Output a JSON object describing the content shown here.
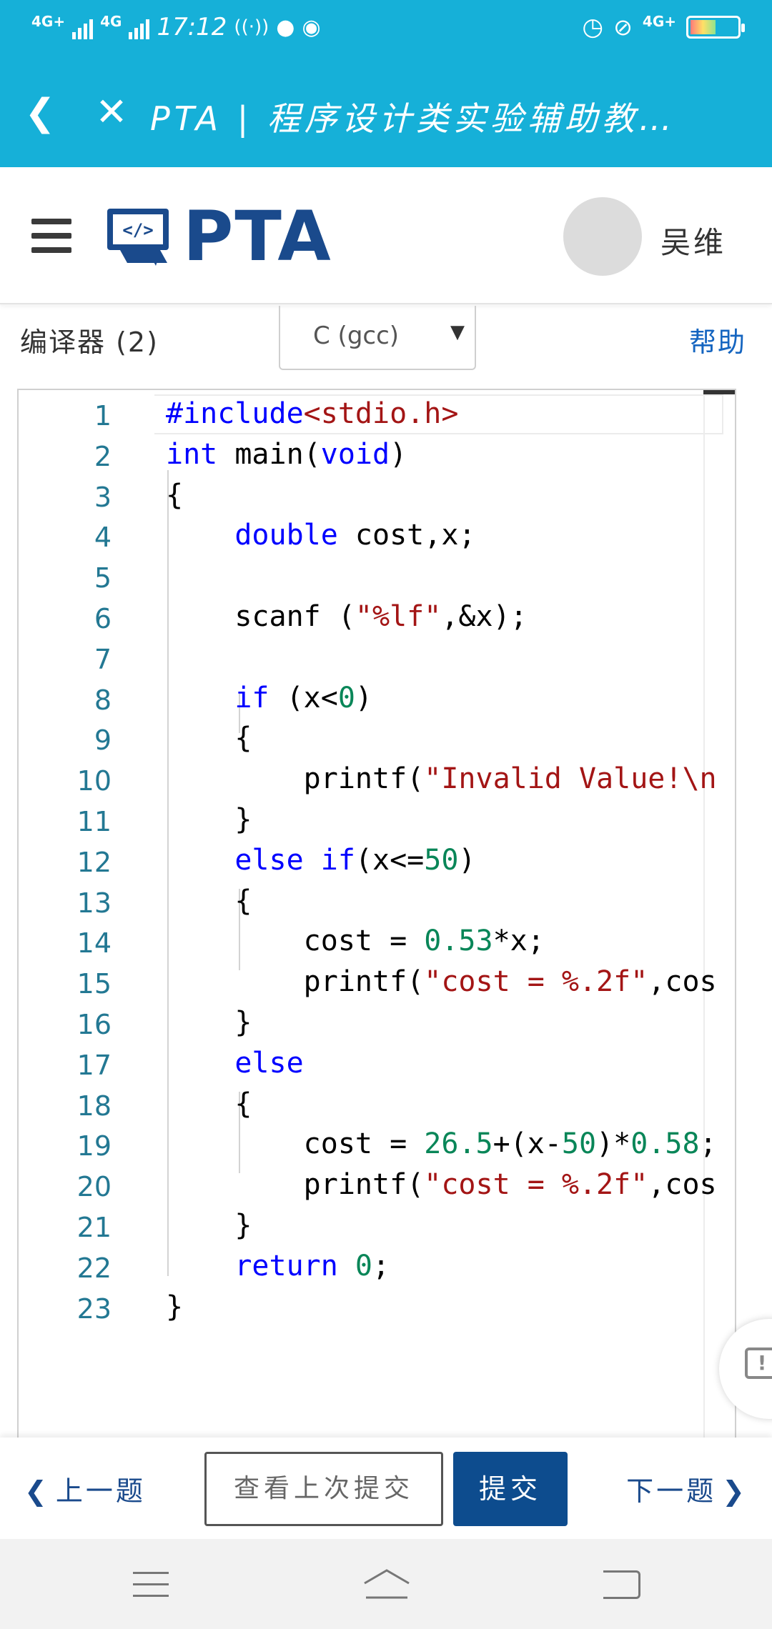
{
  "status_bar": {
    "net1": "4G+",
    "net2": "4G",
    "time": "17:12",
    "net_right": "4G+",
    "battery_level": 0.55
  },
  "browser": {
    "title": "PTA | 程序设计类实验辅助教…"
  },
  "header": {
    "logo_text": "PTA",
    "username": "吴维"
  },
  "toolbar": {
    "compiler_label": "编译器 (2)",
    "language": "C (gcc)",
    "help": "帮助"
  },
  "editor": {
    "lines": [
      {
        "n": "1",
        "tokens": [
          {
            "t": "#include",
            "c": "inc"
          },
          {
            "t": "<stdio.h>",
            "c": "str"
          }
        ]
      },
      {
        "n": "2",
        "tokens": [
          {
            "t": "int",
            "c": "kw"
          },
          {
            "t": " main(",
            "c": ""
          },
          {
            "t": "void",
            "c": "kw"
          },
          {
            "t": ")",
            "c": ""
          }
        ]
      },
      {
        "n": "3",
        "tokens": [
          {
            "t": "{",
            "c": ""
          }
        ]
      },
      {
        "n": "4",
        "tokens": [
          {
            "t": "    ",
            "c": ""
          },
          {
            "t": "double",
            "c": "kw"
          },
          {
            "t": " cost,x;",
            "c": ""
          }
        ]
      },
      {
        "n": "5",
        "tokens": []
      },
      {
        "n": "6",
        "tokens": [
          {
            "t": "    scanf (",
            "c": ""
          },
          {
            "t": "\"%lf\"",
            "c": "str"
          },
          {
            "t": ",&x);",
            "c": ""
          }
        ]
      },
      {
        "n": "7",
        "tokens": []
      },
      {
        "n": "8",
        "tokens": [
          {
            "t": "    ",
            "c": ""
          },
          {
            "t": "if",
            "c": "kw"
          },
          {
            "t": " (x<",
            "c": ""
          },
          {
            "t": "0",
            "c": "num"
          },
          {
            "t": ")",
            "c": ""
          }
        ]
      },
      {
        "n": "9",
        "tokens": [
          {
            "t": "    {",
            "c": ""
          }
        ]
      },
      {
        "n": "10",
        "tokens": [
          {
            "t": "        printf(",
            "c": ""
          },
          {
            "t": "\"Invalid Value!\\n",
            "c": "str"
          }
        ]
      },
      {
        "n": "11",
        "tokens": [
          {
            "t": "    }",
            "c": ""
          }
        ]
      },
      {
        "n": "12",
        "tokens": [
          {
            "t": "    ",
            "c": ""
          },
          {
            "t": "else",
            "c": "kw"
          },
          {
            "t": " ",
            "c": ""
          },
          {
            "t": "if",
            "c": "kw"
          },
          {
            "t": "(x<=",
            "c": ""
          },
          {
            "t": "50",
            "c": "num"
          },
          {
            "t": ")",
            "c": ""
          }
        ]
      },
      {
        "n": "13",
        "tokens": [
          {
            "t": "    {",
            "c": ""
          }
        ]
      },
      {
        "n": "14",
        "tokens": [
          {
            "t": "        cost = ",
            "c": ""
          },
          {
            "t": "0.53",
            "c": "num"
          },
          {
            "t": "*x;",
            "c": ""
          }
        ]
      },
      {
        "n": "15",
        "tokens": [
          {
            "t": "        printf(",
            "c": ""
          },
          {
            "t": "\"cost = %.2f\"",
            "c": "str"
          },
          {
            "t": ",cos",
            "c": ""
          }
        ]
      },
      {
        "n": "16",
        "tokens": [
          {
            "t": "    }",
            "c": ""
          }
        ]
      },
      {
        "n": "17",
        "tokens": [
          {
            "t": "    ",
            "c": ""
          },
          {
            "t": "else",
            "c": "kw"
          }
        ]
      },
      {
        "n": "18",
        "tokens": [
          {
            "t": "    {",
            "c": ""
          }
        ]
      },
      {
        "n": "19",
        "tokens": [
          {
            "t": "        cost = ",
            "c": ""
          },
          {
            "t": "26.5",
            "c": "num"
          },
          {
            "t": "+(x-",
            "c": ""
          },
          {
            "t": "50",
            "c": "num"
          },
          {
            "t": ")*",
            "c": ""
          },
          {
            "t": "0.58",
            "c": "num"
          },
          {
            "t": ";",
            "c": ""
          }
        ]
      },
      {
        "n": "20",
        "tokens": [
          {
            "t": "        printf(",
            "c": ""
          },
          {
            "t": "\"cost = %.2f\"",
            "c": "str"
          },
          {
            "t": ",cos",
            "c": ""
          }
        ]
      },
      {
        "n": "21",
        "tokens": [
          {
            "t": "    }",
            "c": ""
          }
        ]
      },
      {
        "n": "22",
        "tokens": [
          {
            "t": "    ",
            "c": ""
          },
          {
            "t": "return",
            "c": "kw"
          },
          {
            "t": " ",
            "c": ""
          },
          {
            "t": "0",
            "c": "num"
          },
          {
            "t": ";",
            "c": ""
          }
        ]
      },
      {
        "n": "23",
        "tokens": [
          {
            "t": "}",
            "c": ""
          }
        ]
      }
    ]
  },
  "actions": {
    "prev": "上一题",
    "view_last": "查看上次提交",
    "submit": "提交",
    "next": "下一题"
  },
  "colors": {
    "brand_bar": "#16b0d8",
    "brand_dark": "#0d4c8e",
    "line_number": "#237893"
  },
  "icons": {
    "back": "back-arrow-icon",
    "close": "close-icon",
    "menu": "hamburger-menu-icon",
    "feedback": "feedback-icon"
  }
}
